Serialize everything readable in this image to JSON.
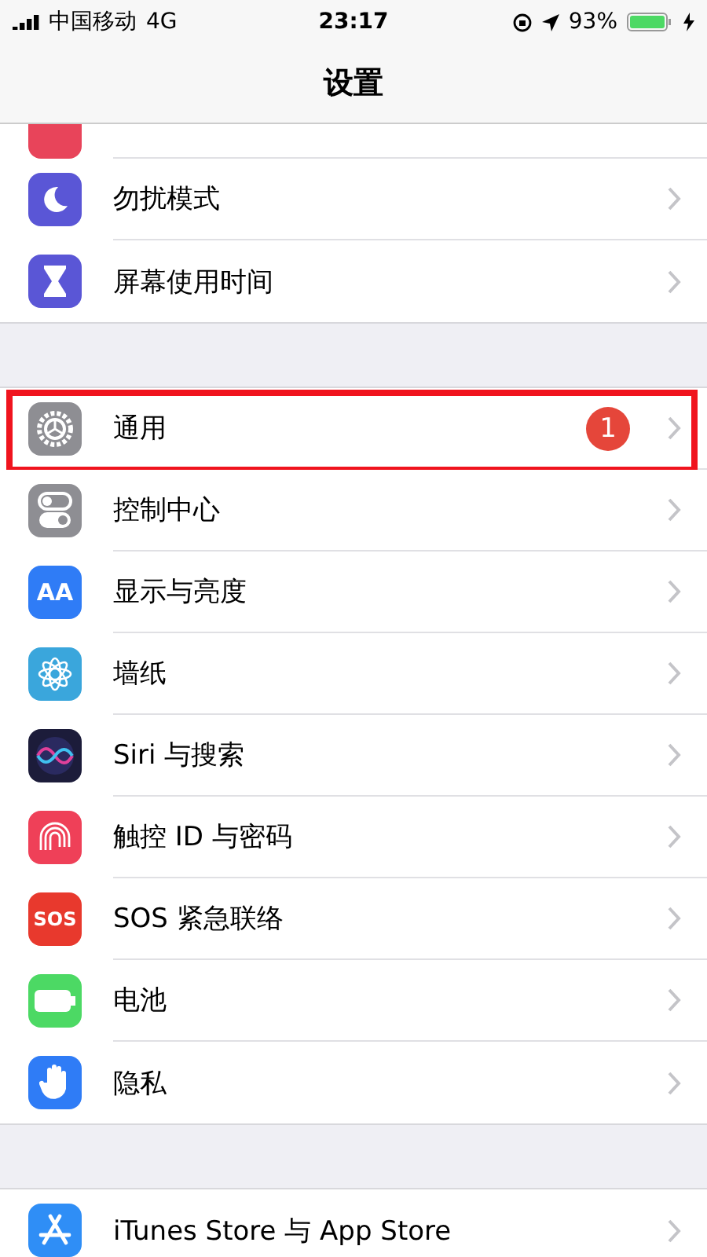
{
  "status_bar": {
    "carrier": "中国移动",
    "network": "4G",
    "time": "23:17",
    "battery": "93%"
  },
  "nav": {
    "title": "设置"
  },
  "groups": [
    {
      "cut_top": true,
      "items": [
        {
          "kind": "blank",
          "color": "#e8445a",
          "highlighted": false
        },
        {
          "kind": "moon",
          "color": "#5a56d6",
          "label": "勿扰模式",
          "highlighted": false
        },
        {
          "kind": "hourglass",
          "color": "#5a56d6",
          "label": "屏幕使用时间",
          "highlighted": false
        }
      ]
    },
    {
      "cut_top": false,
      "items": [
        {
          "kind": "gear",
          "color": "#8e8e93",
          "label": "通用",
          "badge": "1",
          "highlighted": true
        },
        {
          "kind": "toggles",
          "color": "#8e8e93",
          "label": "控制中心",
          "highlighted": false
        },
        {
          "kind": "letters",
          "color": "#2f7cf6",
          "icon_text": "AA",
          "label": "显示与亮度",
          "highlighted": false
        },
        {
          "kind": "flower",
          "color": "#3aa6dc",
          "label": "墙纸",
          "highlighted": false
        },
        {
          "kind": "siri",
          "color": "#1c1c3a",
          "label": "Siri 与搜索",
          "highlighted": false
        },
        {
          "kind": "fingerprint",
          "color": "#ef4058",
          "label": "触控 ID 与密码",
          "highlighted": false
        },
        {
          "kind": "letters",
          "color": "#e8392d",
          "icon_text": "SOS",
          "label": "SOS 紧急联络",
          "highlighted": false
        },
        {
          "kind": "battery",
          "color": "#4cd964",
          "label": "电池",
          "highlighted": false
        },
        {
          "kind": "hand",
          "color": "#2f7cf6",
          "label": "隐私",
          "highlighted": false
        }
      ]
    },
    {
      "cut_top": false,
      "items": [
        {
          "kind": "appstore",
          "color": "#2f8ef6",
          "label": "iTunes Store 与 App Store",
          "highlighted": false
        }
      ]
    }
  ]
}
